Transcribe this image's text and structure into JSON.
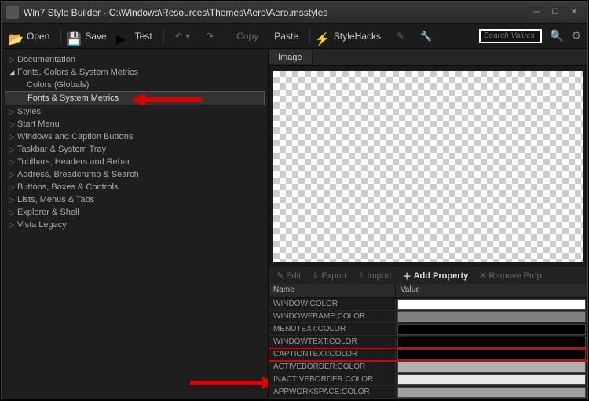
{
  "title": "Win7 Style Builder - C:\\Windows\\Resources\\Themes\\Aero\\Aero.msstyles",
  "toolbar": {
    "open": "Open",
    "save": "Save",
    "test": "Test",
    "copy": "Copy",
    "paste": "Paste",
    "stylehacks": "StyleHacks"
  },
  "search": {
    "placeholder": "Search Values"
  },
  "tree": {
    "items": [
      {
        "label": "Documentation",
        "expanded": false
      },
      {
        "label": "Fonts, Colors & System Metrics",
        "expanded": true,
        "children": [
          {
            "label": "Colors (Globals)",
            "selected": false
          },
          {
            "label": "Fonts & System Metrics",
            "selected": true
          }
        ]
      },
      {
        "label": "Styles",
        "expanded": false
      },
      {
        "label": "Start Menu",
        "expanded": false
      },
      {
        "label": "Windows and Caption Buttons",
        "expanded": false
      },
      {
        "label": "Taskbar & System Tray",
        "expanded": false
      },
      {
        "label": "Toolbars, Headers and Rebar",
        "expanded": false
      },
      {
        "label": "Address, Breadcrumb & Search",
        "expanded": false
      },
      {
        "label": "Buttons, Boxes & Controls",
        "expanded": false
      },
      {
        "label": "Lists, Menus & Tabs",
        "expanded": false
      },
      {
        "label": "Explorer & Shell",
        "expanded": false
      },
      {
        "label": "Vista Legacy",
        "expanded": false
      }
    ]
  },
  "image_tab": "Image",
  "prop_toolbar": {
    "edit": "Edit",
    "export": "Export",
    "import": "Import",
    "add": "Add Property",
    "remove": "Remove Prop"
  },
  "grid": {
    "headers": {
      "name": "Name",
      "value": "Value"
    },
    "rows": [
      {
        "name": "WINDOW:COLOR",
        "color": "#ffffff",
        "highlight": false
      },
      {
        "name": "WINDOWFRAME:COLOR",
        "color": "#808080",
        "highlight": false
      },
      {
        "name": "MENUTEXT:COLOR",
        "color": "#000000",
        "highlight": false
      },
      {
        "name": "WINDOWTEXT:COLOR",
        "color": "#000000",
        "highlight": false
      },
      {
        "name": "CAPTIONTEXT:COLOR",
        "color": "#000000",
        "highlight": true
      },
      {
        "name": "ACTIVEBORDER:COLOR",
        "color": "#b0b0b0",
        "highlight": false
      },
      {
        "name": "INACTIVEBORDER:COLOR",
        "color": "#e8e8e8",
        "highlight": false
      },
      {
        "name": "APPWORKSPACE:COLOR",
        "color": "#a0a0a0",
        "highlight": false
      }
    ]
  }
}
